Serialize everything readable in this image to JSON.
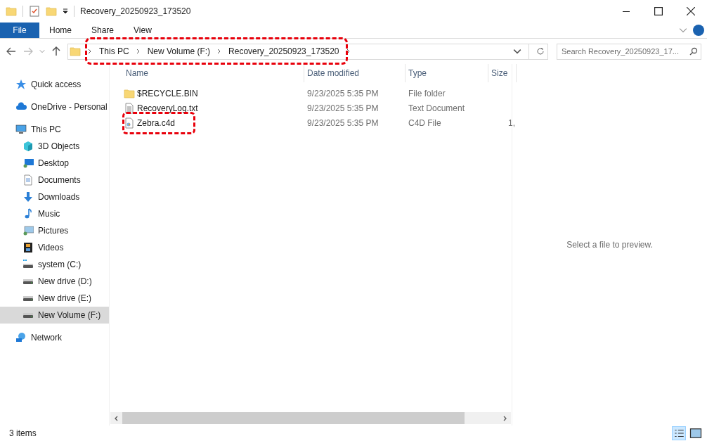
{
  "window": {
    "title": "Recovery_20250923_173520"
  },
  "ribbon_tabs": [
    {
      "label": "File",
      "kind": "file"
    },
    {
      "label": "Home",
      "kind": "tab"
    },
    {
      "label": "Share",
      "kind": "tab"
    },
    {
      "label": "View",
      "kind": "tab"
    }
  ],
  "breadcrumb": [
    "This PC",
    "New Volume (F:)",
    "Recovery_20250923_173520"
  ],
  "search": {
    "placeholder": "Search Recovery_20250923_17..."
  },
  "sidebar": {
    "items": [
      {
        "label": "Quick access",
        "kind": "star",
        "selected": false
      },
      {
        "label": "OneDrive - Personal",
        "kind": "cloud",
        "selected": false
      },
      {
        "label": "This PC",
        "kind": "pc",
        "selected": false,
        "children": [
          {
            "label": "3D Objects",
            "kind": "cube",
            "selected": false
          },
          {
            "label": "Desktop",
            "kind": "desktop",
            "selected": false
          },
          {
            "label": "Documents",
            "kind": "doc",
            "selected": false
          },
          {
            "label": "Downloads",
            "kind": "download",
            "selected": false
          },
          {
            "label": "Music",
            "kind": "music",
            "selected": false
          },
          {
            "label": "Pictures",
            "kind": "pictures",
            "selected": false
          },
          {
            "label": "Videos",
            "kind": "videos",
            "selected": false
          },
          {
            "label": "system (C:)",
            "kind": "sysdrive",
            "selected": false
          },
          {
            "label": "New drive (D:)",
            "kind": "drive",
            "selected": false
          },
          {
            "label": "New drive (E:)",
            "kind": "drive",
            "selected": false
          },
          {
            "label": "New Volume (F:)",
            "kind": "drive",
            "selected": true
          }
        ]
      },
      {
        "label": "Network",
        "kind": "network",
        "selected": false
      }
    ]
  },
  "table": {
    "columns": [
      "Name",
      "Date modified",
      "Type",
      "Size"
    ],
    "rows": [
      {
        "kind": "folder",
        "name": "$RECYCLE.BIN",
        "date": "9/23/2025 5:35 PM",
        "type": "File folder"
      },
      {
        "kind": "text",
        "name": "RecoveryLog.txt",
        "date": "9/23/2025 5:35 PM",
        "type": "Text Document"
      },
      {
        "kind": "c4d",
        "name": "Zebra.c4d",
        "date": "9/23/2025 5:35 PM",
        "type": "C4D File",
        "size": "1,"
      }
    ]
  },
  "preview": {
    "message": "Select a file to preview."
  },
  "status_bar": {
    "count": "3 items"
  }
}
